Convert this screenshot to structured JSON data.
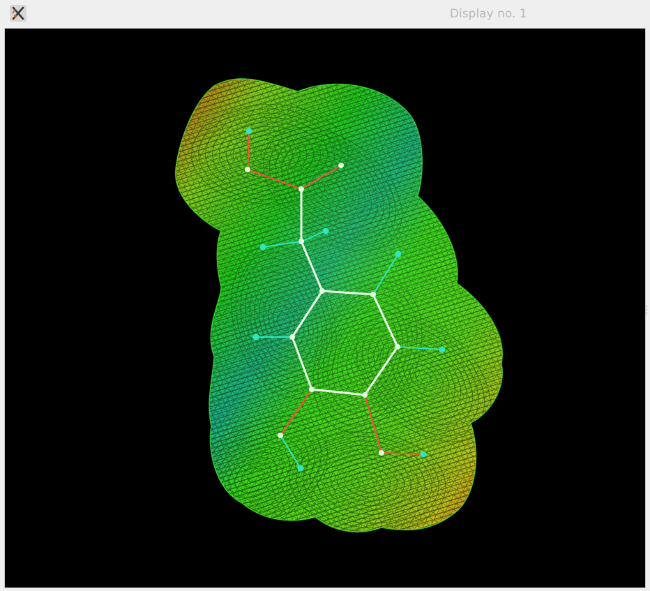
{
  "window": {
    "title": "Display no. 1",
    "app_icon": "x-molecule-app-icon"
  },
  "viewer": {
    "background": "#000000",
    "surface_style": "wireframe electrostatic potential mesh",
    "colors": {
      "negative": "#ff3b12",
      "neutral": "#2fe21a",
      "mid": "#9eea1c",
      "positive": "#1aa8a0",
      "bond": "#e8ffe8",
      "hydrogen": "#2fe6c0",
      "oxygen_bond": "#ff4a3a"
    }
  }
}
